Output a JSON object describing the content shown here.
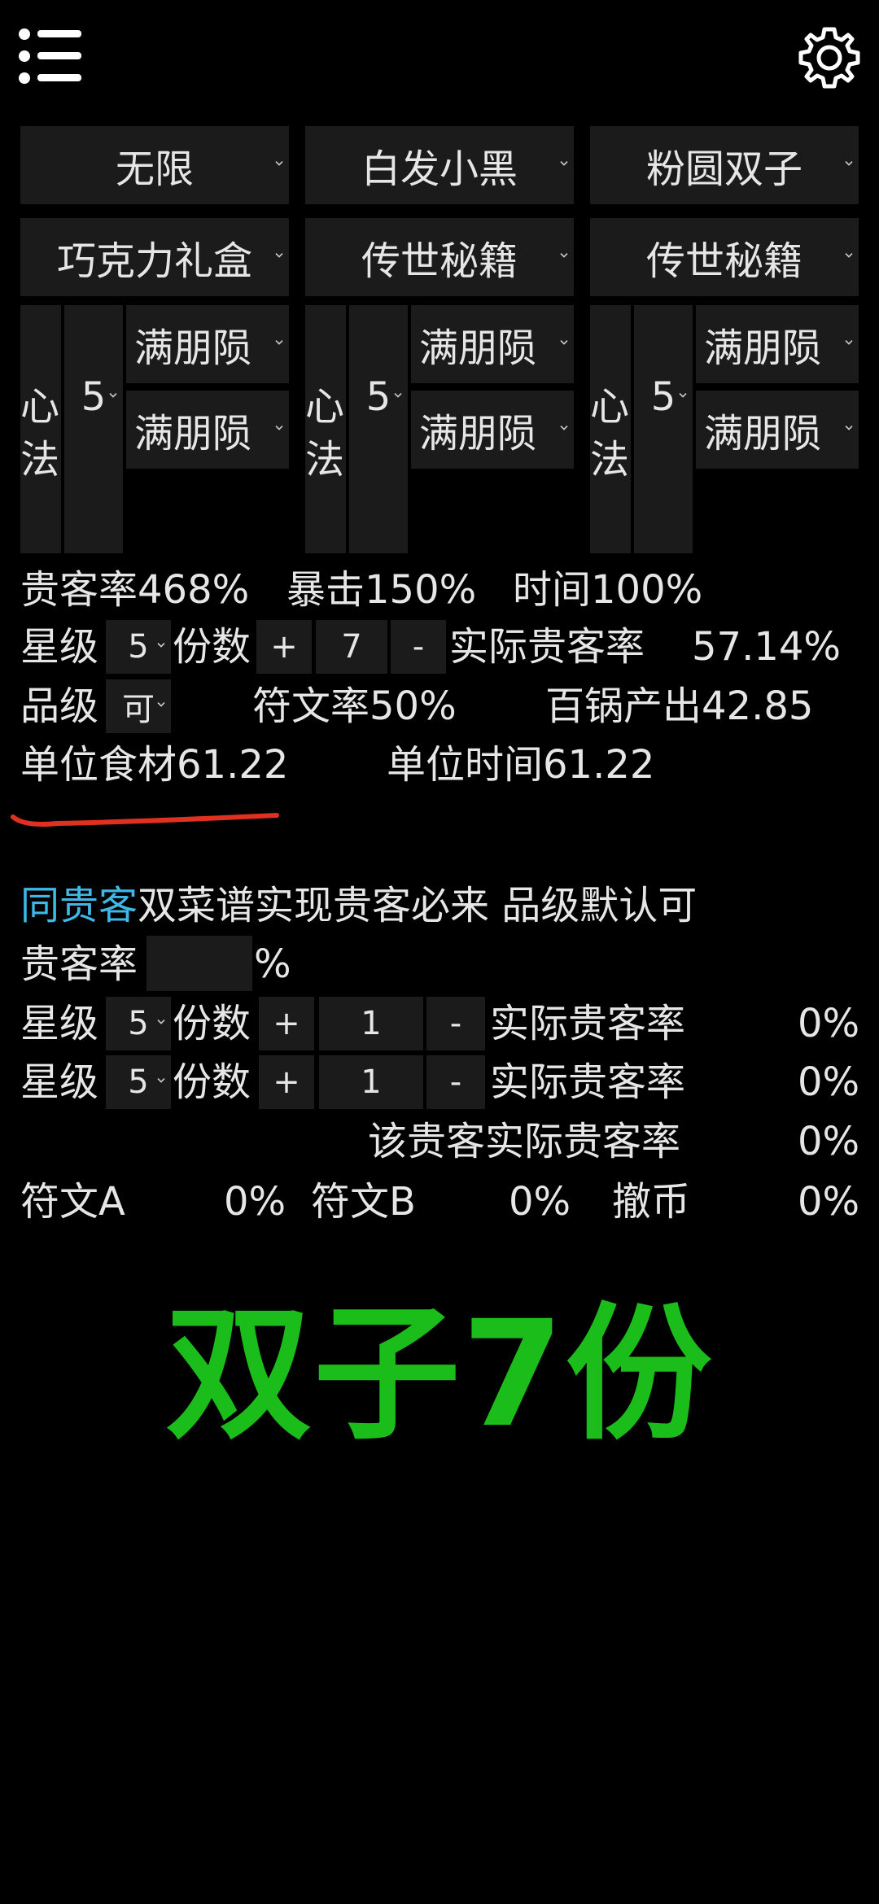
{
  "header": {
    "menu_icon": "menu-icon",
    "settings_icon": "gear-icon"
  },
  "top_row1": [
    "无限",
    "白发小黑",
    "粉圆双子"
  ],
  "top_row2": [
    "巧克力礼盒",
    "传世秘籍",
    "传世秘籍"
  ],
  "columns": [
    {
      "label_a": "心",
      "label_b": "法",
      "level": "5",
      "item1": "满朋陨",
      "item2": "满朋陨"
    },
    {
      "label_a": "心",
      "label_b": "法",
      "level": "5",
      "item1": "满朋陨",
      "item2": "满朋陨"
    },
    {
      "label_a": "心",
      "label_b": "法",
      "level": "5",
      "item1": "满朋陨",
      "item2": "满朋陨"
    }
  ],
  "stats": {
    "guest_rate": "贵客率468%",
    "crit": "暴击150%",
    "time": "时间100%",
    "star_label": "星级",
    "star_value": "5",
    "portions_label": "份数",
    "plus": "+",
    "portions_value": "7",
    "minus": "-",
    "actual_rate_label": "实际贵客率",
    "actual_rate_value": "57.14%",
    "grade_label": "品级",
    "grade_value": "可",
    "rune_rate": "符文率50%",
    "pot_output": "百锅产出42.85",
    "unit_food": "单位食材61.22",
    "unit_time": "单位时间61.22"
  },
  "same_guest": {
    "title_highlight": "同贵客",
    "title_rest": "双菜谱实现贵客必来 品级默认可",
    "guest_rate_label": "贵客率",
    "guest_rate_input": "",
    "percent": "%",
    "rows": [
      {
        "star_label": "星级",
        "star_value": "5",
        "portions_label": "份数",
        "plus": "+",
        "portions_value": "1",
        "minus": "-",
        "rate_label": "实际贵客率",
        "rate_value": "0%"
      },
      {
        "star_label": "星级",
        "star_value": "5",
        "portions_label": "份数",
        "plus": "+",
        "portions_value": "1",
        "minus": "-",
        "rate_label": "实际贵客率",
        "rate_value": "0%"
      }
    ],
    "guest_actual_label": "该贵客实际贵客率",
    "guest_actual_value": "0%",
    "rune_a_label": "符文A",
    "rune_a_value": "0%",
    "rune_b_label": "符文B",
    "rune_b_value": "0%",
    "withdraw_label": "撤币",
    "withdraw_value": "0%"
  },
  "overlay_text": "双子7份",
  "colors": {
    "accent_blue": "#3fb8e6",
    "overlay_green": "#1bbd1b",
    "annotation_red": "#e0301f"
  }
}
